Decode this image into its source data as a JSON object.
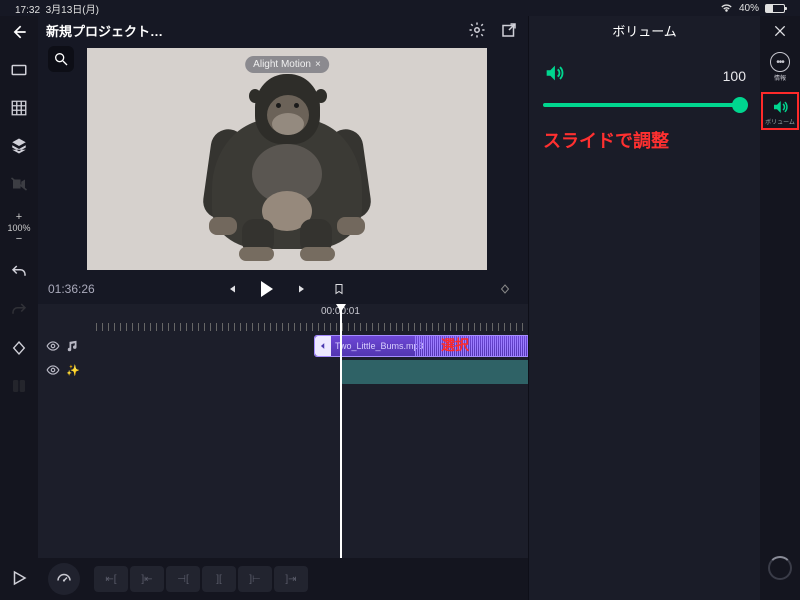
{
  "status": {
    "time": "17:32",
    "date": "3月13日(月)",
    "battery": "40%"
  },
  "header": {
    "project_title": "新規プロジェクト…",
    "watermark": "Alight Motion"
  },
  "left_tools": {
    "zoom": "100%"
  },
  "transport": {
    "timecode": "01:36:26",
    "ruler_label": "00:00:01"
  },
  "timeline": {
    "audio_clip_name": "Two_Little_Bums.mp3",
    "select_label": "選択"
  },
  "panel": {
    "title": "ボリューム",
    "value": "100",
    "annotation": "スライドで調整"
  },
  "far_right": {
    "info_label": "情報",
    "volume_label": "ボリューム"
  }
}
